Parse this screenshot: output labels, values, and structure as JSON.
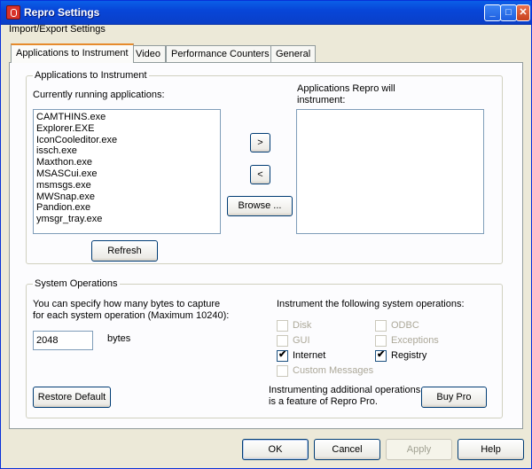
{
  "window": {
    "title": "Repro Settings"
  },
  "menu": {
    "items": [
      "Import/Export Settings"
    ]
  },
  "tabs": [
    "Applications to Instrument",
    "Video",
    "Performance Counters",
    "General"
  ],
  "apps_group": {
    "legend": "Applications to Instrument",
    "running_label": "Currently running applications:",
    "repro_label_1": "Applications Repro will",
    "repro_label_2": "instrument:",
    "running_apps": [
      "CAMTHINS.exe",
      "Explorer.EXE",
      "IconCooleditor.exe",
      "issch.exe",
      "Maxthon.exe",
      "MSASCui.exe",
      "msmsgs.exe",
      "MWSnap.exe",
      "Pandion.exe",
      "ymsgr_tray.exe"
    ],
    "instrumented_apps": [],
    "add_button": ">",
    "remove_button": "<",
    "browse_button": "Browse ...",
    "refresh_button": "Refresh"
  },
  "sysops_group": {
    "legend": "System Operations",
    "desc_1": "You can specify how many bytes to capture",
    "desc_2": "for each system operation (Maximum 10240):",
    "bytes_value": "2048",
    "bytes_unit": "bytes",
    "instrument_label": "Instrument the following system operations:",
    "options": [
      {
        "label": "Disk",
        "checked": false,
        "enabled": false
      },
      {
        "label": "ODBC",
        "checked": false,
        "enabled": false
      },
      {
        "label": "GUI",
        "checked": false,
        "enabled": false
      },
      {
        "label": "Exceptions",
        "checked": false,
        "enabled": false
      },
      {
        "label": "Internet",
        "checked": true,
        "enabled": true
      },
      {
        "label": "Registry",
        "checked": true,
        "enabled": true
      },
      {
        "label": "Custom Messages",
        "checked": false,
        "enabled": false
      }
    ],
    "restore_button": "Restore Default",
    "pro_note_1": "Instrumenting additional operations",
    "pro_note_2": "is a feature of Repro Pro.",
    "buy_button": "Buy Pro"
  },
  "footer": {
    "ok": "OK",
    "cancel": "Cancel",
    "apply": "Apply",
    "help": "Help"
  },
  "colors": {
    "titlebar": "#0a5fe8",
    "window_bg": "#ece9d8",
    "tab_highlight": "#e68b2c"
  }
}
